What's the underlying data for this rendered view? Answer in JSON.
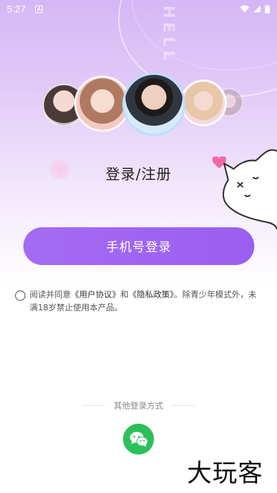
{
  "status_bar": {
    "time": "5:27",
    "notification_letter": "A"
  },
  "decor": {
    "background_text": "HELL"
  },
  "avatars": [
    {
      "name": "avatar-girl-left"
    },
    {
      "name": "avatar-girl-main"
    },
    {
      "name": "avatar-boy-center"
    },
    {
      "name": "avatar-girl-right"
    },
    {
      "name": "avatar-far-right"
    }
  ],
  "title": "登录/注册",
  "phone_login_button": "手机号登录",
  "agreement": {
    "prefix": "阅读并同意",
    "user_agreement": "《用户协议》",
    "and": "和",
    "privacy_policy": "《隐私政策》",
    "suffix": "。除青少年模式外，未满18岁禁止使用本产品。"
  },
  "other_login": {
    "label": "其他登录方式",
    "wechat_icon": "wechat-icon"
  },
  "watermark": "大玩客",
  "colors": {
    "accent": "#9b5ef0",
    "wechat": "#2cc05a"
  }
}
